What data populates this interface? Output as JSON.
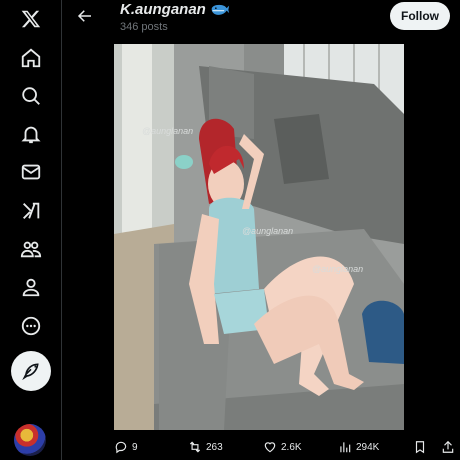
{
  "header": {
    "title": "K.aunganan",
    "badge_icon": "whale-emoji",
    "subtitle": "346 posts",
    "follow_label": "Follow"
  },
  "nav": {
    "items": [
      "x-logo-icon",
      "home-icon",
      "search-icon",
      "notifications-icon",
      "messages-icon",
      "grok-icon",
      "communities-icon",
      "profile-icon",
      "more-icon"
    ],
    "compose_icon": "compose-feather-icon"
  },
  "photo": {
    "watermarks": [
      "@aunglanan",
      "@aunglanan",
      "@aunglanan"
    ]
  },
  "actions": {
    "replies": "9",
    "reposts": "263",
    "likes": "2.6K",
    "views": "294K"
  },
  "colors": {
    "background": "#000000",
    "text": "#e7e9ea",
    "muted": "#71767b",
    "follow_bg": "#eff3f4"
  }
}
